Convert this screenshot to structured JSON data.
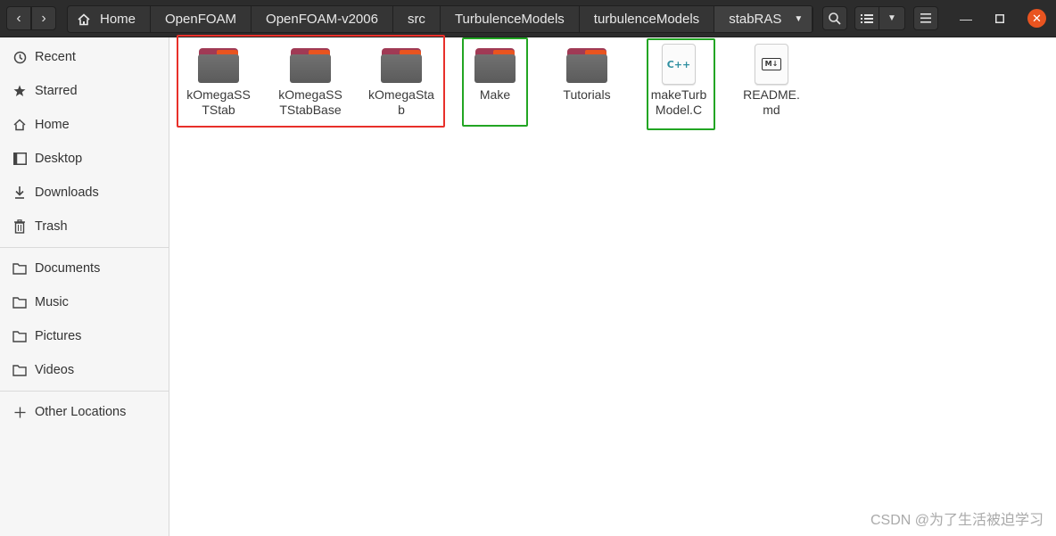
{
  "header": {
    "breadcrumbs": [
      "Home",
      "OpenFOAM",
      "OpenFOAM-v2006",
      "src",
      "TurbulenceModels",
      "turbulenceModels",
      "stabRAS"
    ]
  },
  "sidebar": {
    "items": [
      {
        "label": "Recent",
        "icon": "clock-icon"
      },
      {
        "label": "Starred",
        "icon": "star-icon"
      },
      {
        "label": "Home",
        "icon": "home-icon"
      },
      {
        "label": "Desktop",
        "icon": "desktop-icon"
      },
      {
        "label": "Downloads",
        "icon": "download-icon"
      },
      {
        "label": "Trash",
        "icon": "trash-icon"
      }
    ],
    "places": [
      {
        "label": "Documents",
        "icon": "folder-icon"
      },
      {
        "label": "Music",
        "icon": "folder-icon"
      },
      {
        "label": "Pictures",
        "icon": "folder-icon"
      },
      {
        "label": "Videos",
        "icon": "folder-icon"
      }
    ],
    "other": {
      "label": "Other Locations",
      "icon": "plus-icon"
    }
  },
  "files": [
    {
      "name": "kOmegaSSTStab",
      "line1": "kOmegaSS",
      "line2": "TStab",
      "type": "folder"
    },
    {
      "name": "kOmegaSSTStabBase",
      "line1": "kOmegaSS",
      "line2": "TStabBase",
      "type": "folder"
    },
    {
      "name": "kOmegaStab",
      "line1": "kOmegaSta",
      "line2": "b",
      "type": "folder"
    },
    {
      "name": "Make",
      "line1": "Make",
      "line2": "",
      "type": "folder"
    },
    {
      "name": "Tutorials",
      "line1": "Tutorials",
      "line2": "",
      "type": "folder"
    },
    {
      "name": "makeTurbModel.C",
      "line1": "makeTurb",
      "line2": "Model.C",
      "type": "cpp-file",
      "badge": "C++"
    },
    {
      "name": "README.md",
      "line1": "README.",
      "line2": "md",
      "type": "markdown-file",
      "badge": "M↓"
    }
  ],
  "watermark": "CSDN @为了生活被迫学习",
  "colors": {
    "accent": "#e95420",
    "highlight_red": "#e8302a",
    "highlight_green": "#22a523"
  }
}
